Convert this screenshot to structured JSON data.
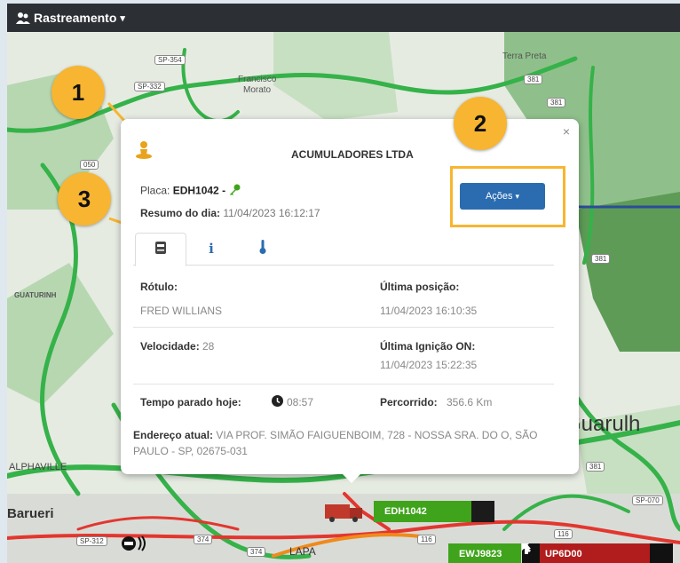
{
  "topbar": {
    "title": "Rastreamento",
    "caret": "▾"
  },
  "map": {
    "labels": {
      "terra_preta": "Terra Preta",
      "francisco": "Francisco",
      "morato": "Morato",
      "guaturinho": "GUATURINH",
      "alphaville": "ALPHAVILLE",
      "barueri": "Barueri",
      "guarulhos": "Guarulh",
      "lapa": "LAPA"
    },
    "shields": {
      "sp354": "SP-354",
      "sp332": "SP-332",
      "r381a": "381",
      "r381b": "381",
      "r050": "050",
      "r381c": "381",
      "r381d": "381",
      "sp070": "SP-070",
      "sp312": "SP-312",
      "r374a": "374",
      "r374b": "374",
      "r116": "116",
      "r116b": "116"
    }
  },
  "popup": {
    "company": "ACUMULADORES LTDA",
    "close": "×",
    "plate_label": "Placa:",
    "plate_value": "EDH1042 -",
    "summary_label": "Resumo do dia:",
    "summary_value": "11/04/2023 16:12:17",
    "actions_button": "Ações",
    "actions_caret": "▾",
    "tabs": [
      "tab-summary-icon",
      "tab-info-icon",
      "tab-temperature-icon"
    ],
    "label_field": "Rótulo:",
    "label_value": "FRED WILLIANS",
    "last_pos_label": "Última posição:",
    "last_pos_value": "11/04/2023 16:10:35",
    "speed_label": "Velocidade:",
    "speed_value": "28",
    "last_ign_label": "Última Ignição ON:",
    "last_ign_value": "11/04/2023 15:22:35",
    "stopped_label": "Tempo parado hoje:",
    "stopped_value": "08:57",
    "distance_label": "Percorrido:",
    "distance_value": "356.6 Km",
    "address_label": "Endereço atual:",
    "address_value": "VIA PROF. SIMÃO FAIGUENBOIM, 728 - NOSSA SRA. DO O, SÃO PAULO - SP, 02675-031"
  },
  "callouts": {
    "one": "1",
    "two": "2",
    "three": "3"
  },
  "vehicles": {
    "edh": "EDH1042",
    "ewj": "EWJ9823",
    "up": "UP6D00"
  },
  "colors": {
    "accent": "#2b6cb0",
    "callout": "#f7b531",
    "vehicle_green": "#3fa41b",
    "vehicle_red": "#b11d1d"
  }
}
